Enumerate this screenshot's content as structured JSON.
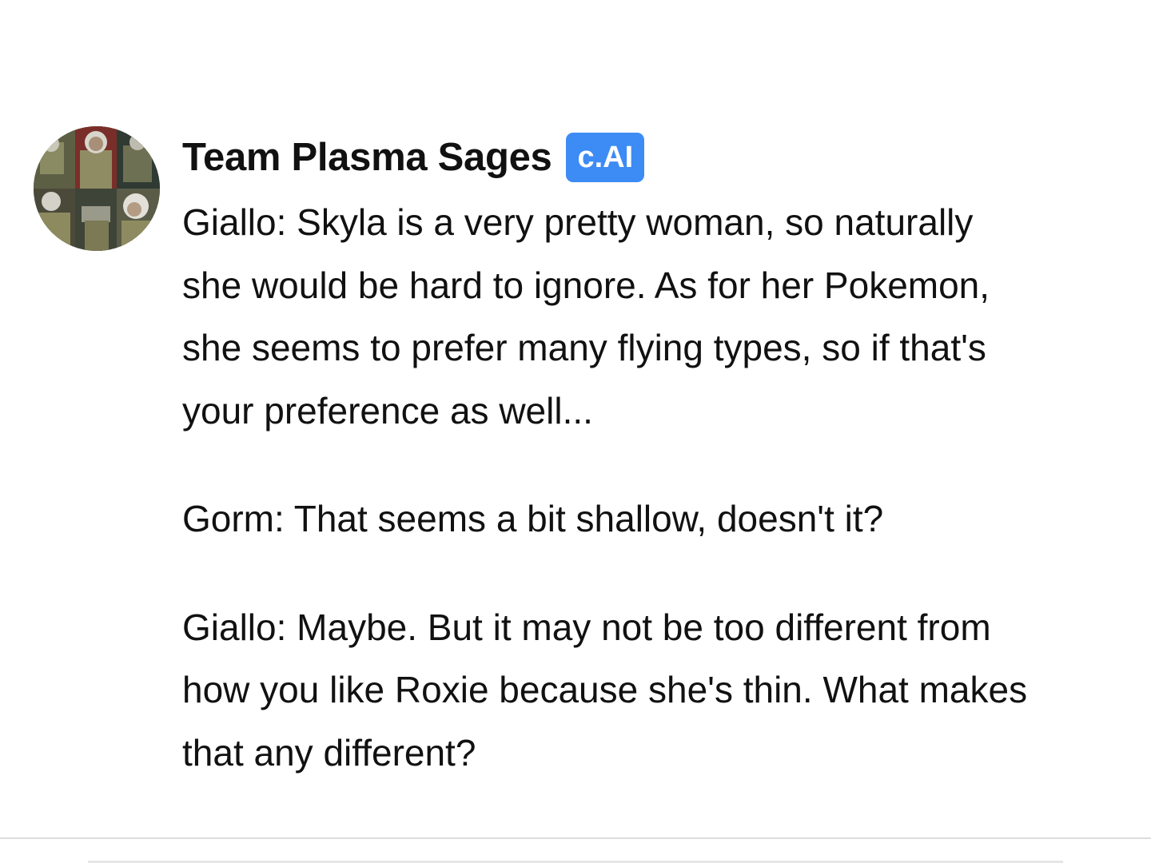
{
  "message": {
    "author": "Team Plasma Sages",
    "badge": "c.AI",
    "avatar_icon": "avatar-collage",
    "badge_color": "#3d8bf5",
    "paragraphs": [
      "Giallo: Skyla is a very pretty woman, so naturally she would be hard to ignore. As for her Pokemon, she seems to prefer many flying types, so if that's your preference as well...",
      "Gorm: That seems a bit shallow, doesn't it?",
      "Giallo: Maybe. But it may not be too different from how you like Roxie because she's thin. What makes that any different?"
    ]
  }
}
